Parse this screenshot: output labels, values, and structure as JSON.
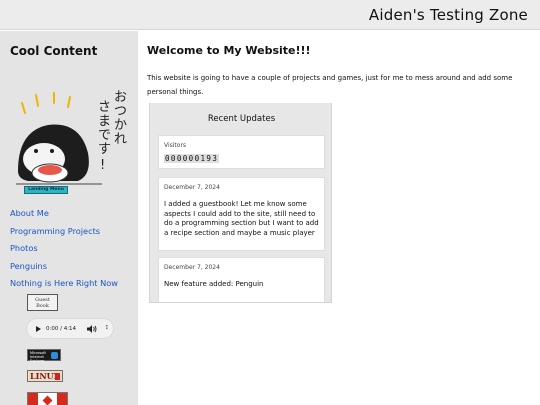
{
  "header": {
    "site_title": "Aiden's Testing Zone"
  },
  "sidebar": {
    "title": "Cool Content",
    "mascot_caption": "おつかれさまです!",
    "landing_badge": "Landing Menu",
    "nav": [
      {
        "label": "About Me"
      },
      {
        "label": "Programming Projects"
      },
      {
        "label": "Photos"
      },
      {
        "label": "Penguins"
      },
      {
        "label": "Nothing is Here Right Now"
      }
    ],
    "guestbook_button": "Guest Book",
    "audio": {
      "time": "0:00 / 4:14"
    },
    "badges": {
      "ie": "Microsoft Internet Explorer",
      "linux": "LINUX"
    }
  },
  "main": {
    "heading": "Welcome to My Website!!!",
    "intro": "This website is going to have a couple of projects and games, just for me to mess around and add some personal things.",
    "updates": {
      "title": "Recent Updates",
      "visitors_label": "Visitors",
      "visitors_count": "000000193",
      "entries": [
        {
          "date": "December 7, 2024",
          "text": "I added a guestbook! Let me know some aspects I could add to the site, still need to do a programming section but I want to add a recipe section and maybe a music player"
        },
        {
          "date": "December 7, 2024",
          "text": "New feature added: Penguin"
        }
      ]
    }
  },
  "colors": {
    "link": "#1a55c8",
    "sidebar_bg": "#e4e4e4",
    "header_bg": "#ececec",
    "badge_teal": "#2fb4c4"
  }
}
